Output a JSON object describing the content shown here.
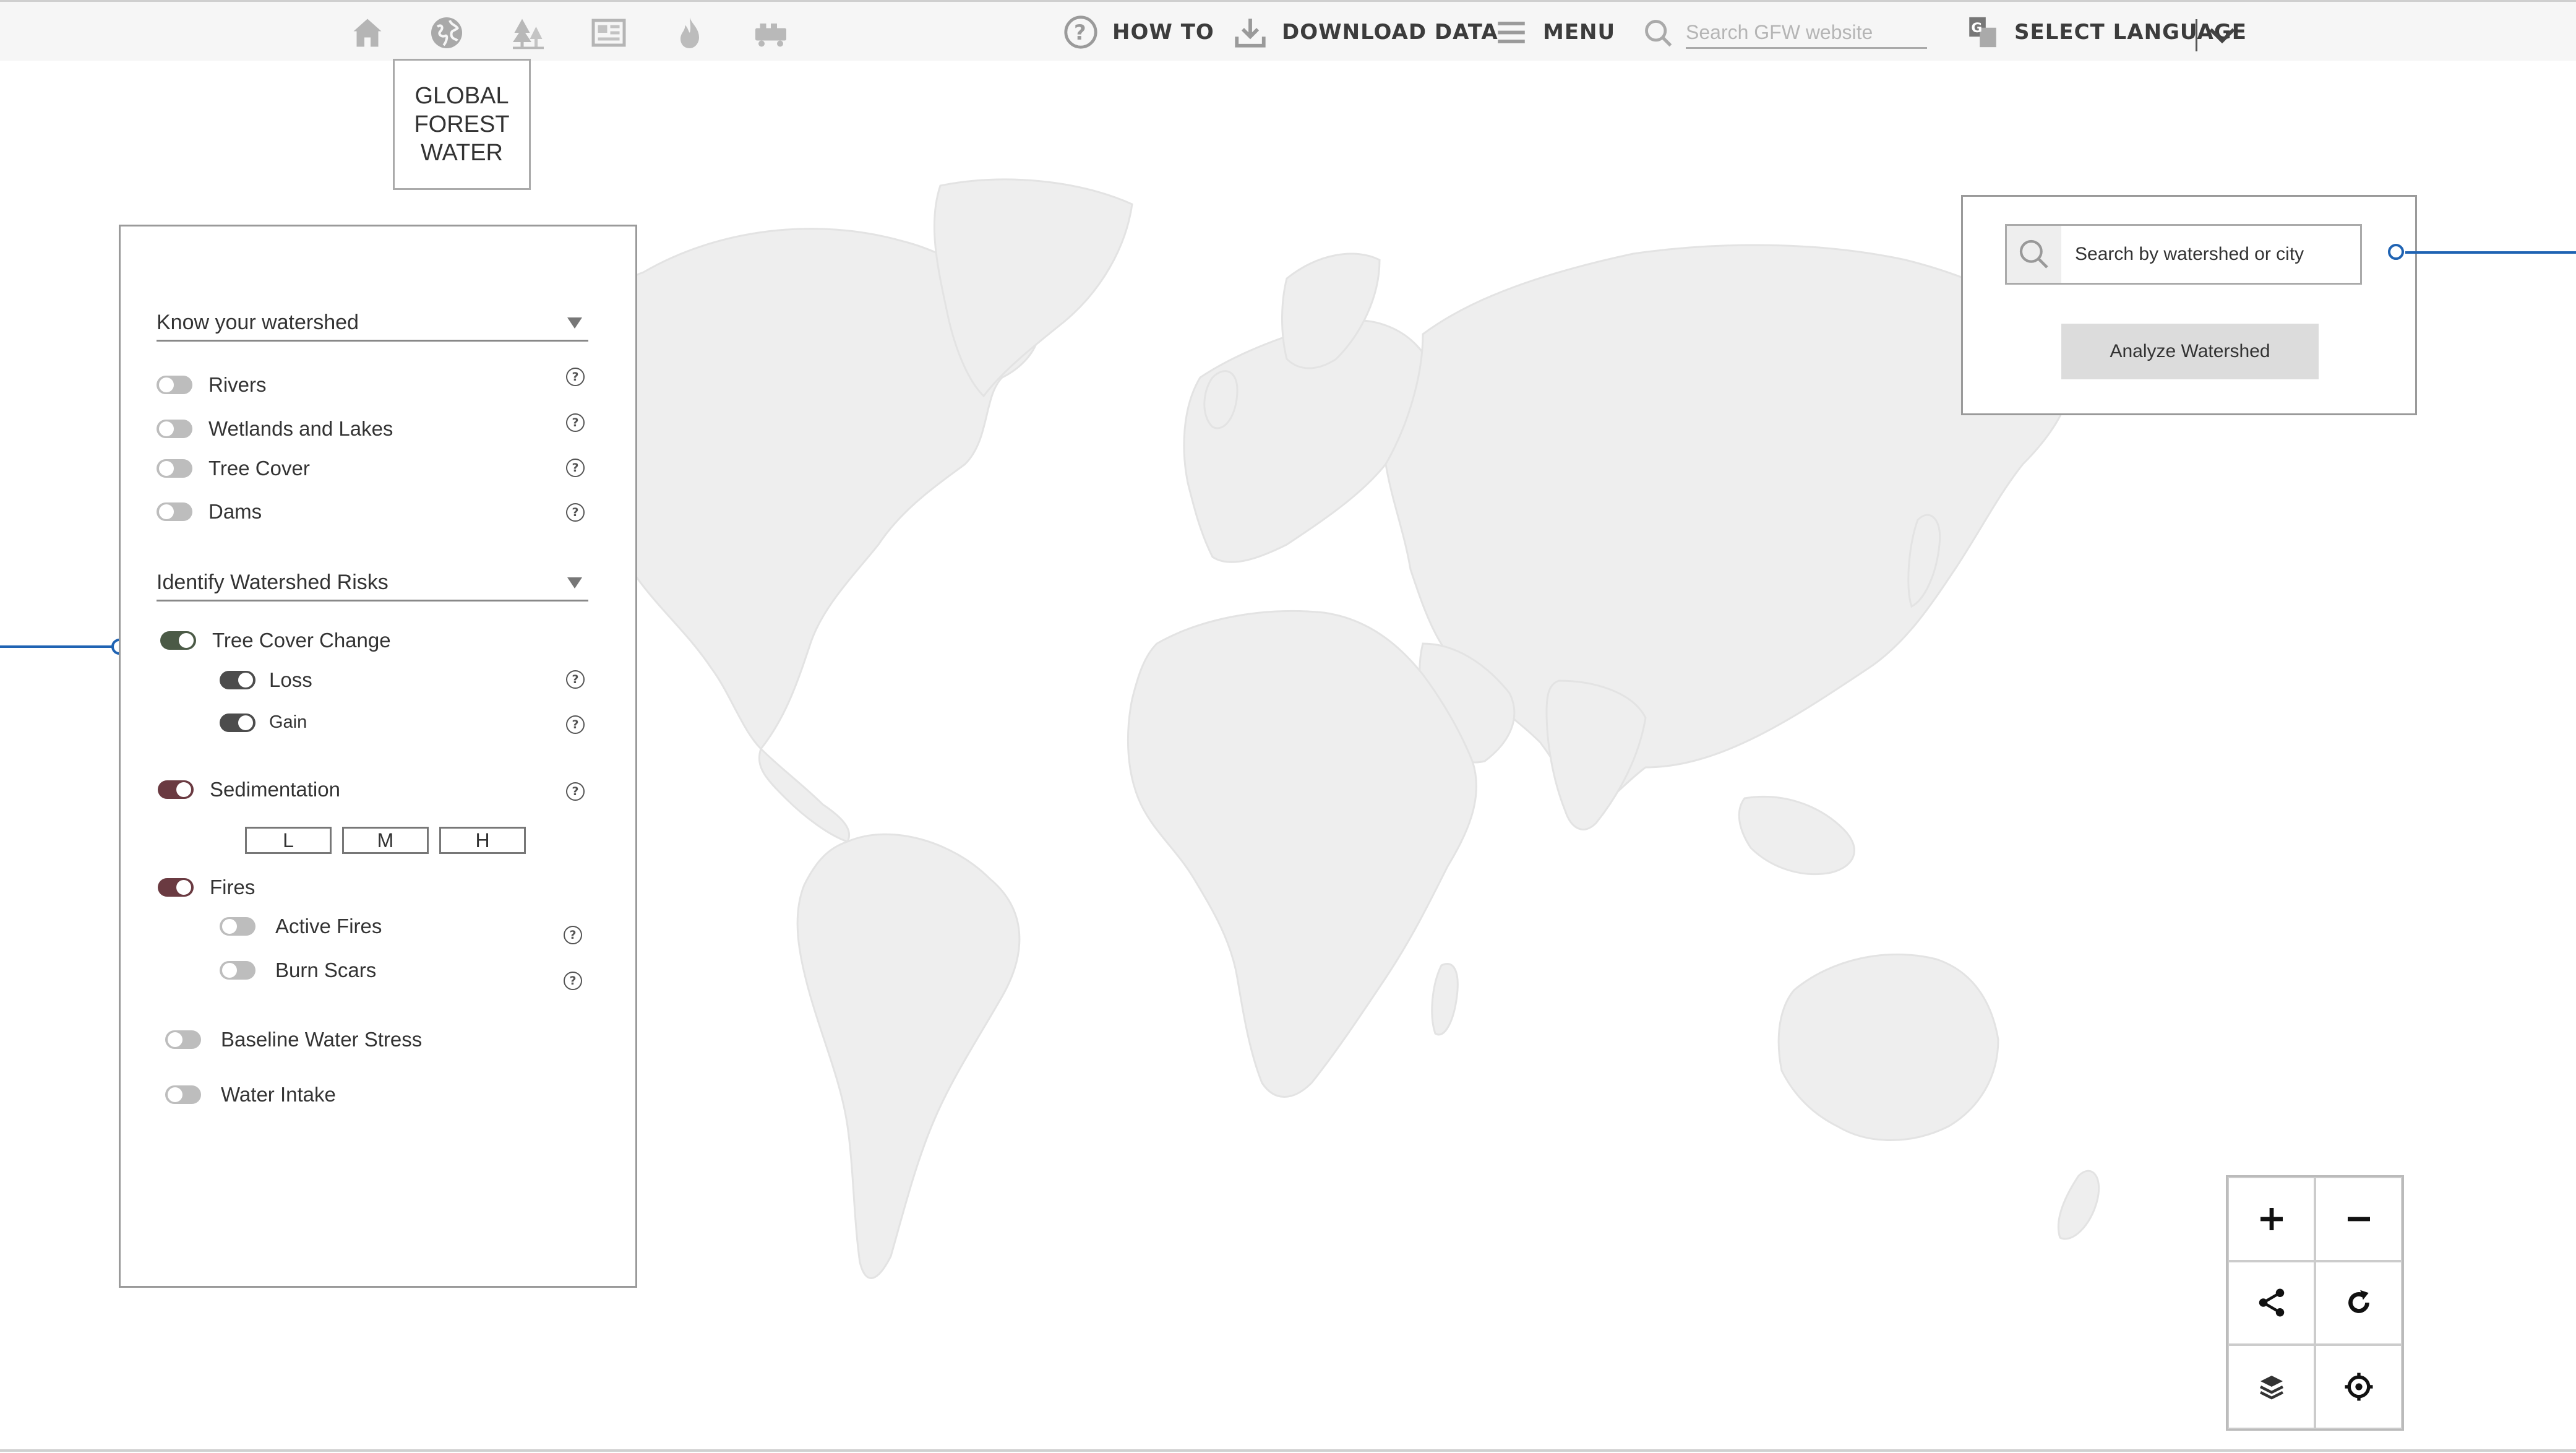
{
  "topbar": {
    "icons": [
      "home-icon",
      "globe-icon",
      "forest-icon",
      "map-icon",
      "fire-icon",
      "commodities-icon"
    ],
    "howto_label": "HOW TO",
    "download_label": "DOWNLOAD DATA",
    "menu_label": "MENU",
    "search_placeholder": "Search GFW website",
    "language_label": "SELECT LANGUAGE"
  },
  "app_label": {
    "line1": "GLOBAL",
    "line2": "FOREST",
    "line3": "WATER"
  },
  "panel": {
    "section1": {
      "title": "Know your watershed",
      "items": [
        {
          "label": "Rivers",
          "on": false
        },
        {
          "label": "Wetlands and Lakes",
          "on": false
        },
        {
          "label": "Tree Cover",
          "on": false
        },
        {
          "label": "Dams",
          "on": false
        }
      ]
    },
    "section2": {
      "title": "Identify Watershed Risks",
      "tree_cover_change": {
        "label": "Tree Cover Change",
        "loss": "Loss",
        "gain": "Gain"
      },
      "sedimentation": {
        "label": "Sedimentation",
        "levels": [
          "L",
          "M",
          "H"
        ]
      },
      "fires": {
        "label": "Fires",
        "active": "Active Fires",
        "burn": "Burn Scars"
      },
      "baseline_water_stress": "Baseline Water Stress",
      "water_intake": "Water Intake"
    }
  },
  "search_panel": {
    "placeholder": "Search by watershed or city",
    "analyze_label": "Analyze Watershed"
  },
  "map_controls": [
    "zoom-in-icon",
    "zoom-out-icon",
    "share-icon",
    "reset-icon",
    "layers-icon",
    "locate-icon"
  ],
  "colors": {
    "accent_line": "#1f63b3",
    "toggle_green": "#4b5a46",
    "toggle_maroon": "#6a3a41",
    "land": "#eeeeee"
  }
}
